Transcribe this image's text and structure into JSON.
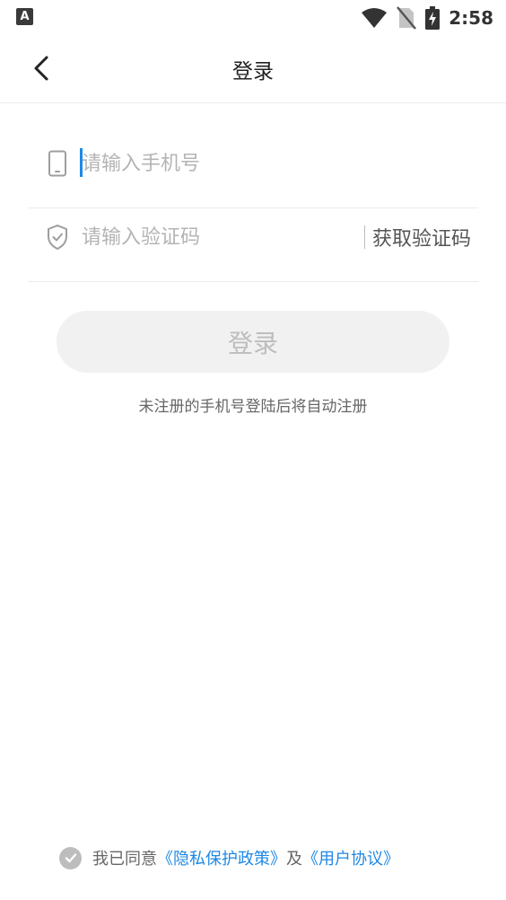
{
  "status_bar": {
    "app_badge": "A",
    "time": "2:58",
    "icons": [
      "wifi-icon",
      "no-sim-icon",
      "battery-charging-icon"
    ]
  },
  "nav": {
    "title": "登录",
    "back_icon": "chevron-left-icon"
  },
  "phone_field": {
    "icon": "phone-icon",
    "placeholder": "请输入手机号",
    "value": ""
  },
  "code_field": {
    "icon": "shield-check-icon",
    "placeholder": "请输入验证码",
    "value": "",
    "get_code_label": "获取验证码"
  },
  "login_button": {
    "label": "登录"
  },
  "hint": "未注册的手机号登陆后将自动注册",
  "agreement": {
    "checkbox_icon": "check-circle-icon",
    "prefix": "我已同意",
    "privacy_link": "《隐私保护政策》",
    "joiner": "及",
    "user_link": "《用户协议》"
  },
  "colors": {
    "link": "#1e88e5",
    "button_bg": "#f1f1f1",
    "button_text": "#bdbdbd",
    "cursor": "#1e88e5"
  }
}
